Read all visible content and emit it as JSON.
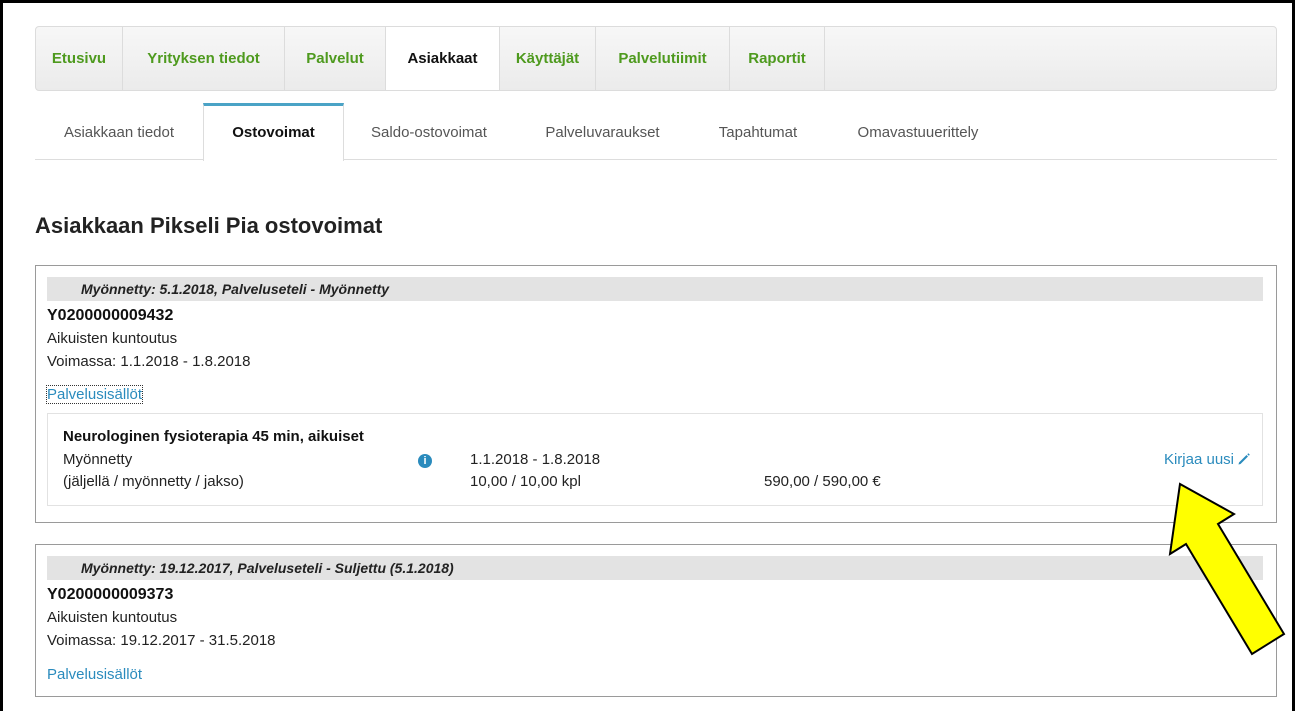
{
  "topnav": {
    "items": [
      "Etusivu",
      "Yrityksen tiedot",
      "Palvelut",
      "Asiakkaat",
      "Käyttäjät",
      "Palvelutiimit",
      "Raportit"
    ],
    "active": "Asiakkaat"
  },
  "subtabs": {
    "items": [
      "Asiakkaan tiedot",
      "Ostovoimat",
      "Saldo-ostovoimat",
      "Palveluvaraukset",
      "Tapahtumat",
      "Omavastuuerittely"
    ],
    "active": "Ostovoimat"
  },
  "page": {
    "title": "Asiakkaan Pikseli Pia ostovoimat"
  },
  "cards": [
    {
      "header": "Myönnetty:  5.1.2018, Palveluseteli - Myönnetty",
      "code": "Y0200000009432",
      "type": "Aikuisten kuntoutus",
      "validity": "Voimassa:  1.1.2018 - 1.8.2018",
      "link": "Palvelusisällöt",
      "service": {
        "name": "Neurologinen fysioterapia 45 min, aikuiset",
        "status": "Myönnetty",
        "legend": "(jäljellä / myönnetty / jakso)",
        "period": "1.1.2018 - 1.8.2018",
        "quantity": "10,00 / 10,00 kpl",
        "amount": "590,00 / 590,00 €",
        "action": "Kirjaa uusi"
      }
    },
    {
      "header": "Myönnetty:  19.12.2017, Palveluseteli - Suljettu (5.1.2018)",
      "code": "Y0200000009373",
      "type": "Aikuisten kuntoutus",
      "validity": "Voimassa:  19.12.2017 - 31.5.2018",
      "link": "Palvelusisällöt"
    }
  ],
  "icons": {
    "info": "info-icon",
    "edit": "pencil-icon",
    "annotation": "yellow-arrow"
  },
  "colors": {
    "nav_link": "#4e9a1e",
    "link": "#2a8bbd",
    "active_tab_border": "#4aa3c6",
    "arrow": "#ffff00"
  }
}
